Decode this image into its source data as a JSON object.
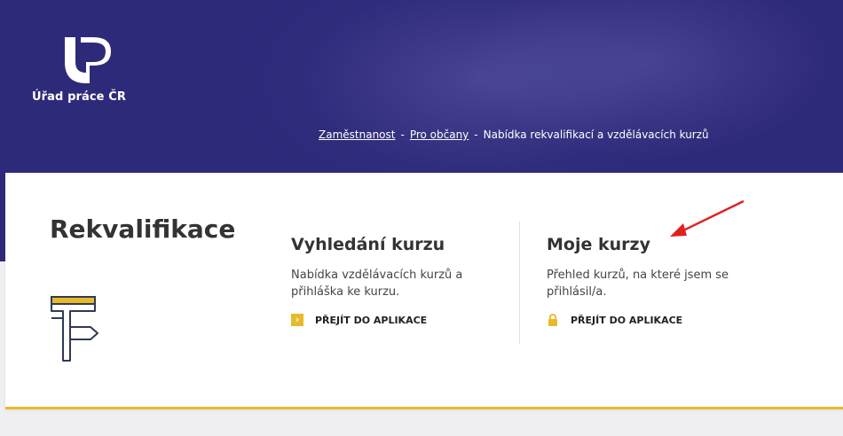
{
  "header": {
    "logo_text": "Úřad práce ČR",
    "breadcrumb": {
      "items": [
        "Zaměstnanost",
        "Pro občany"
      ],
      "current": "Nabídka rekvalifikací a vzdělávacích kurzů",
      "separator": "-"
    }
  },
  "card": {
    "title": "Rekvalifikace",
    "columns": [
      {
        "heading": "Vyhledání kurzu",
        "description": "Nabídka vzdělávacích kurzů a přihláška ke kurzu.",
        "action_label": "PŘEJÍT DO APLIKACE",
        "action_icon": "chevron-right-icon"
      },
      {
        "heading": "Moje kurzy",
        "description": "Přehled kurzů, na které jsem se přihlásil/a.",
        "action_label": "PŘEJÍT DO APLIKACE",
        "action_icon": "lock-icon"
      }
    ]
  },
  "colors": {
    "header_bg": "#2e2a7a",
    "accent": "#e8b929",
    "annotation_arrow": "#e02020"
  }
}
